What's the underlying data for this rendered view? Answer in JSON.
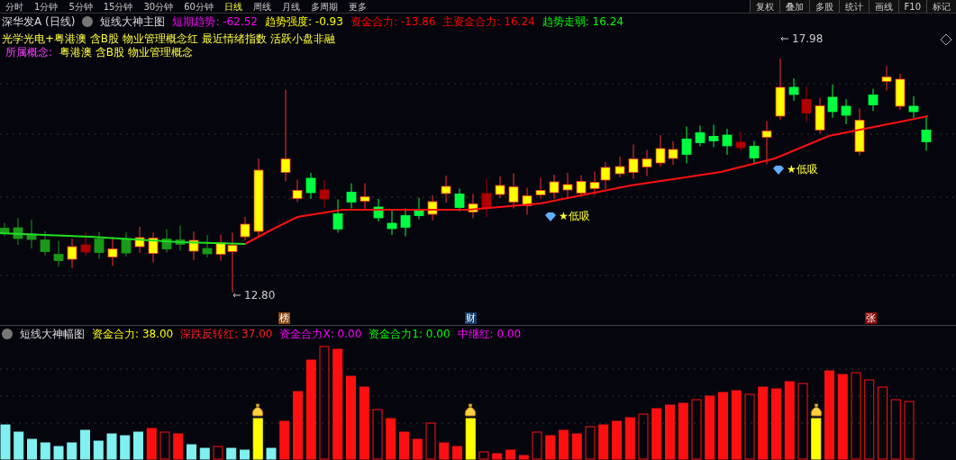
{
  "toolbar": {
    "left": [
      {
        "label": "分时",
        "selected": false
      },
      {
        "label": "1分钟",
        "selected": false
      },
      {
        "label": "5分钟",
        "selected": false
      },
      {
        "label": "15分钟",
        "selected": false
      },
      {
        "label": "30分钟",
        "selected": false
      },
      {
        "label": "60分钟",
        "selected": false
      },
      {
        "label": "日线",
        "selected": true
      },
      {
        "label": "周线",
        "selected": false
      },
      {
        "label": "月线",
        "selected": false
      },
      {
        "label": "多周期",
        "selected": false
      },
      {
        "label": "更多",
        "selected": false
      }
    ],
    "right": [
      "复权",
      "叠加",
      "多股",
      "统计",
      "画线",
      "F10",
      "标记"
    ]
  },
  "main_legend": {
    "stock": "深华发A (日线)",
    "indicator": "短线大神主图",
    "values": [
      {
        "label": "短期趋势:",
        "value": "-62.52",
        "color": "#ff00ff"
      },
      {
        "label": "趋势强度:",
        "value": "-0.93",
        "color": "#ffff00"
      },
      {
        "label": "资金合力:",
        "value": "-13.86",
        "color": "#ff0000"
      },
      {
        "label": "主资金合力:",
        "value": "16.24",
        "color": "#ff0000"
      },
      {
        "label": "趋势走弱:",
        "value": "16.24",
        "color": "#00ff00"
      }
    ]
  },
  "concepts": {
    "overlap_line": "光学光电+粤港澳 含B股 物业管理概念红 最近情绪指数 活跃小盘非融",
    "label": "所属概念:",
    "items": "粤港澳 含B股 物业管理概念"
  },
  "price_chart": {
    "high_label": "17.98",
    "low_label": "12.80",
    "signals": [
      {
        "text": "★低吸"
      },
      {
        "text": "★低吸"
      }
    ],
    "markers": [
      {
        "text": "榜",
        "color": "#8b4a10"
      },
      {
        "text": "财",
        "color": "#103c6e"
      },
      {
        "text": "张",
        "color": "#8b0a0a"
      }
    ]
  },
  "volume_legend": {
    "indicator": "短线大神幅图",
    "values": [
      {
        "label": "资金合力:",
        "value": "38.00",
        "color": "#ffff00"
      },
      {
        "label": "深跌反转红:",
        "value": "37.00",
        "color": "#ff2020"
      },
      {
        "label": "资金合力X:",
        "value": "0.00",
        "color": "#ff00ff"
      },
      {
        "label": "资金合力1:",
        "value": "0.00",
        "color": "#00ff00"
      },
      {
        "label": "中继红:",
        "value": "0.00",
        "color": "#ff00ff"
      }
    ]
  }
}
